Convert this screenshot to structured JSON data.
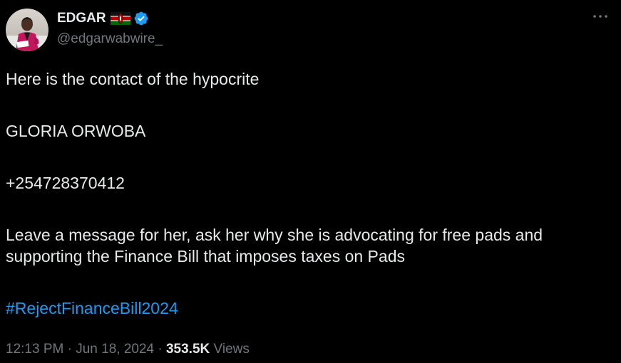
{
  "author": {
    "display_name": "EDGAR",
    "handle": "@edgarwabwire_",
    "flag": "kenya-flag",
    "verified_icon": "verified-badge-icon",
    "verified_color": "#1d9bf0"
  },
  "tweet": {
    "line_1": "Here is the contact of the hypocrite",
    "line_2": "GLORIA ORWOBA",
    "line_3": "+254728370412",
    "line_4a": "Leave a message for her, ask her why she is advocating for free pads and",
    "line_4b": "supporting the Finance Bill that imposes taxes on Pads",
    "hashtag": "#RejectFinanceBill2024"
  },
  "meta": {
    "time": "12:13 PM",
    "separator": " · ",
    "date": "Jun 18, 2024",
    "views_count": "353.5K",
    "views_label": " Views"
  },
  "colors": {
    "background": "#000000",
    "text": "#e7e9ea",
    "secondary": "#71767b",
    "link": "#1d9bf0"
  },
  "icons": {
    "more": "more-dots-icon"
  }
}
